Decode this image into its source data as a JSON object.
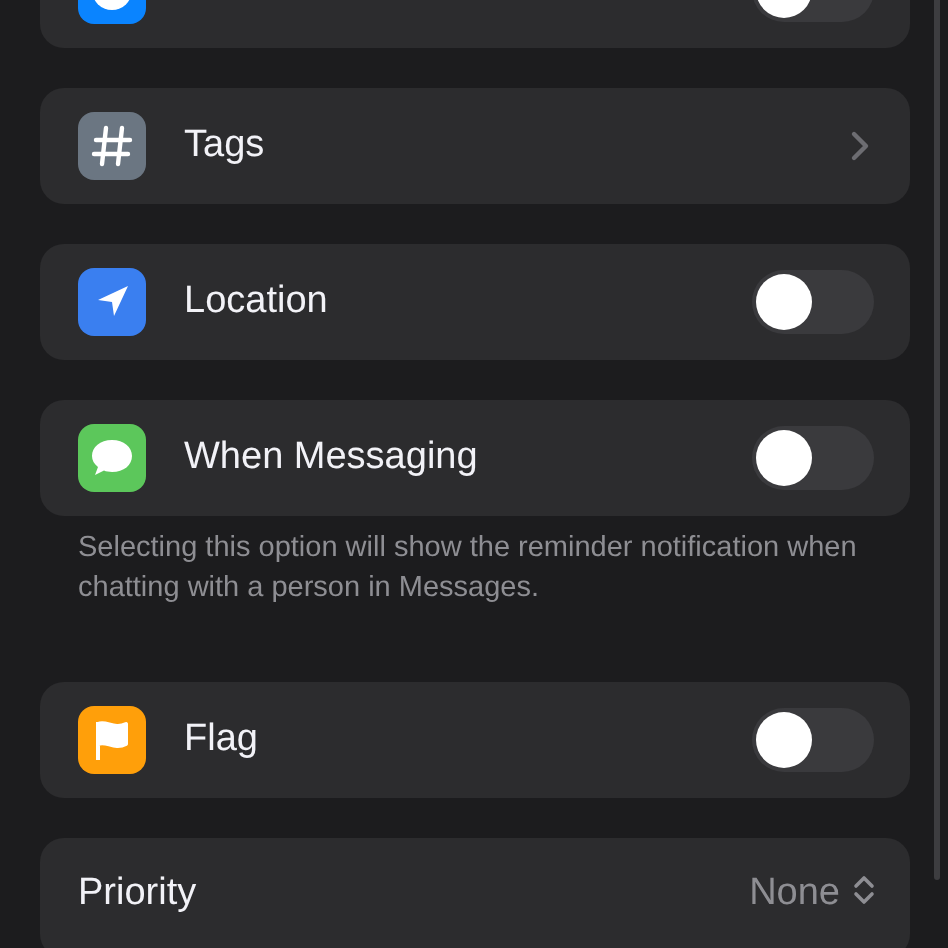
{
  "rows": [
    {
      "kind": "toggle",
      "icon": {
        "kind": "clock",
        "color": "#0a84ff"
      },
      "on": false
    },
    {
      "kind": "link",
      "icon": {
        "kind": "hash",
        "color": "#6b7682"
      },
      "label": "Tags"
    },
    {
      "kind": "toggle",
      "icon": {
        "kind": "arrow",
        "color": "#3a7ff0"
      },
      "label": "Location",
      "on": false
    },
    {
      "kind": "toggle",
      "icon": {
        "kind": "bubble",
        "color": "#5cc75b"
      },
      "label": "When Messaging",
      "on": false,
      "footer": "Selecting this option will show the reminder notification when chatting with a person in Messages."
    },
    {
      "kind": "toggle",
      "icon": {
        "kind": "flag",
        "color": "#ff9f0a"
      },
      "label": "Flag",
      "on": false
    },
    {
      "kind": "picker",
      "label": "Priority",
      "value": "None"
    }
  ]
}
